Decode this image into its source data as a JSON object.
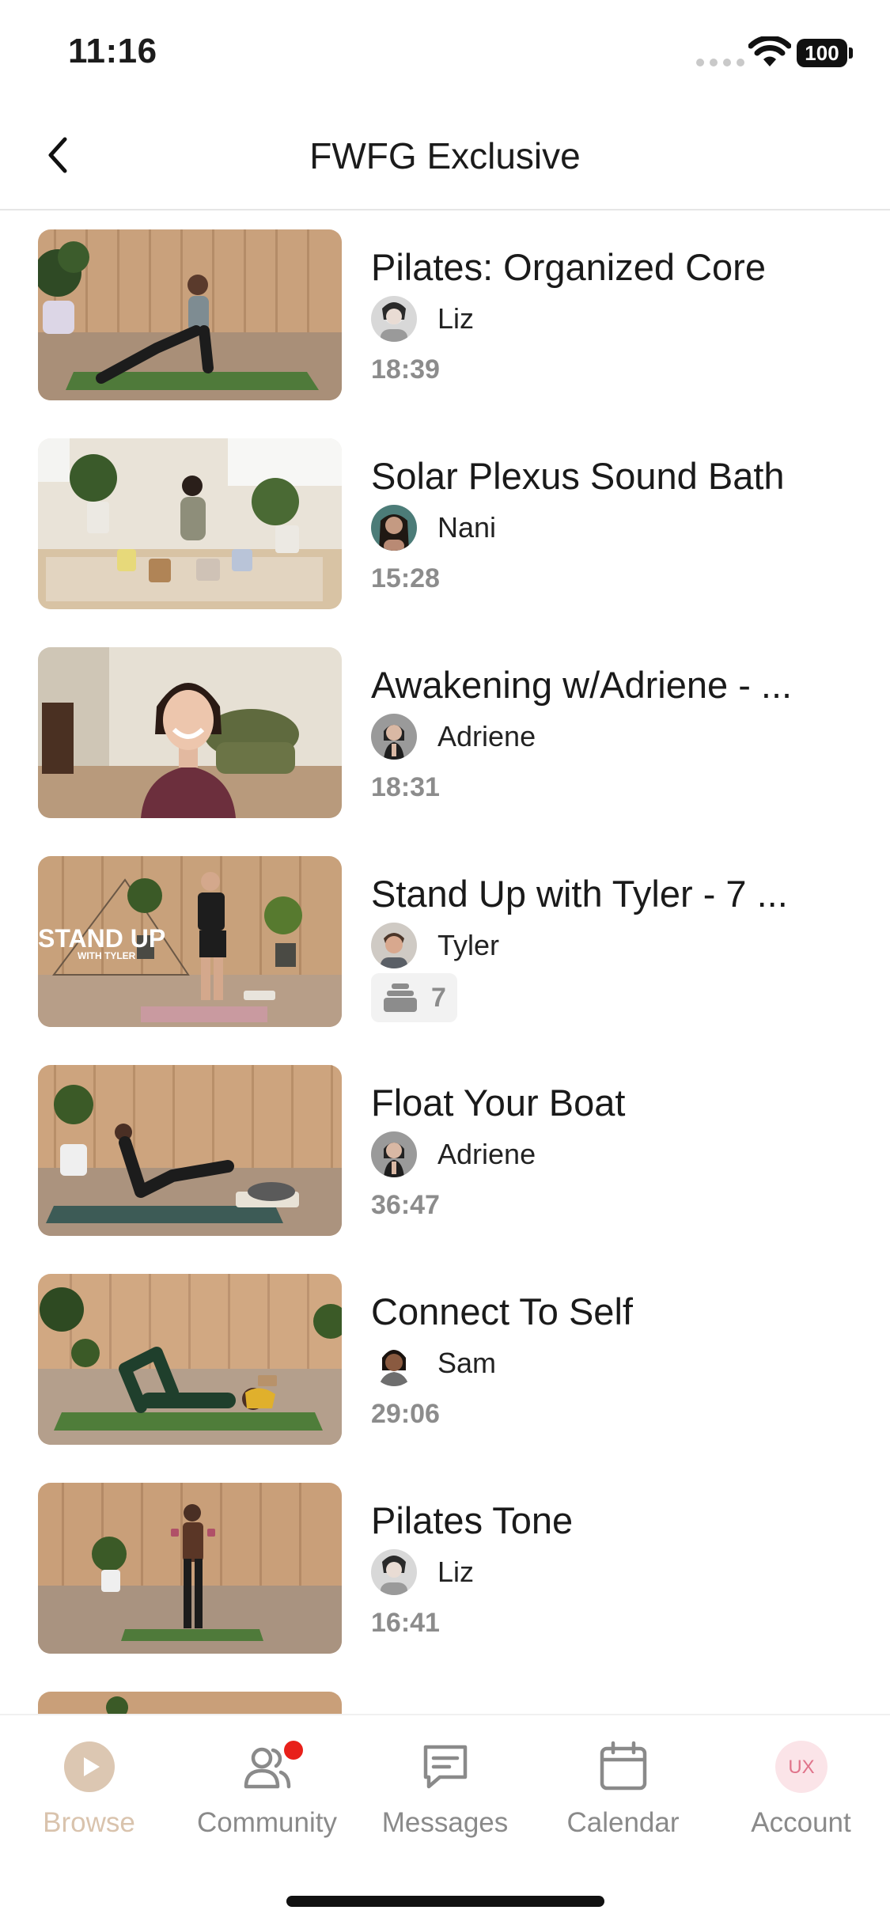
{
  "status_bar": {
    "time": "11:16",
    "battery": "100"
  },
  "header": {
    "title": "FWFG Exclusive"
  },
  "videos": [
    {
      "title": "Pilates: Organized Core",
      "instructor": "Liz",
      "duration": "18:39"
    },
    {
      "title": "Solar Plexus Sound Bath",
      "instructor": "Nani",
      "duration": "15:28"
    },
    {
      "title": "Awakening w/Adriene - ...",
      "instructor": "Adriene",
      "duration": "18:31"
    },
    {
      "title": "Stand Up with Tyler - 7 ...",
      "instructor": "Tyler",
      "series_count": "7",
      "thumb_text": "STAND UP",
      "thumb_subtext": "WITH TYLER"
    },
    {
      "title": "Float Your Boat",
      "instructor": "Adriene",
      "duration": "36:47"
    },
    {
      "title": "Connect To Self",
      "instructor": "Sam",
      "duration": "29:06"
    },
    {
      "title": "Pilates Tone",
      "instructor": "Liz",
      "duration": "16:41"
    }
  ],
  "tabs": [
    {
      "label": "Browse",
      "icon": "play-circle-icon",
      "active": true
    },
    {
      "label": "Community",
      "icon": "community-icon",
      "badge": true
    },
    {
      "label": "Messages",
      "icon": "message-icon"
    },
    {
      "label": "Calendar",
      "icon": "calendar-icon"
    },
    {
      "label": "Account",
      "icon": "account-avatar",
      "avatar_text": "UX"
    }
  ],
  "colors": {
    "active_tab": "#d9c3ad",
    "inactive_tab": "#8a8a8a",
    "notification": "#e8201a",
    "duration": "#8c8c8c"
  }
}
